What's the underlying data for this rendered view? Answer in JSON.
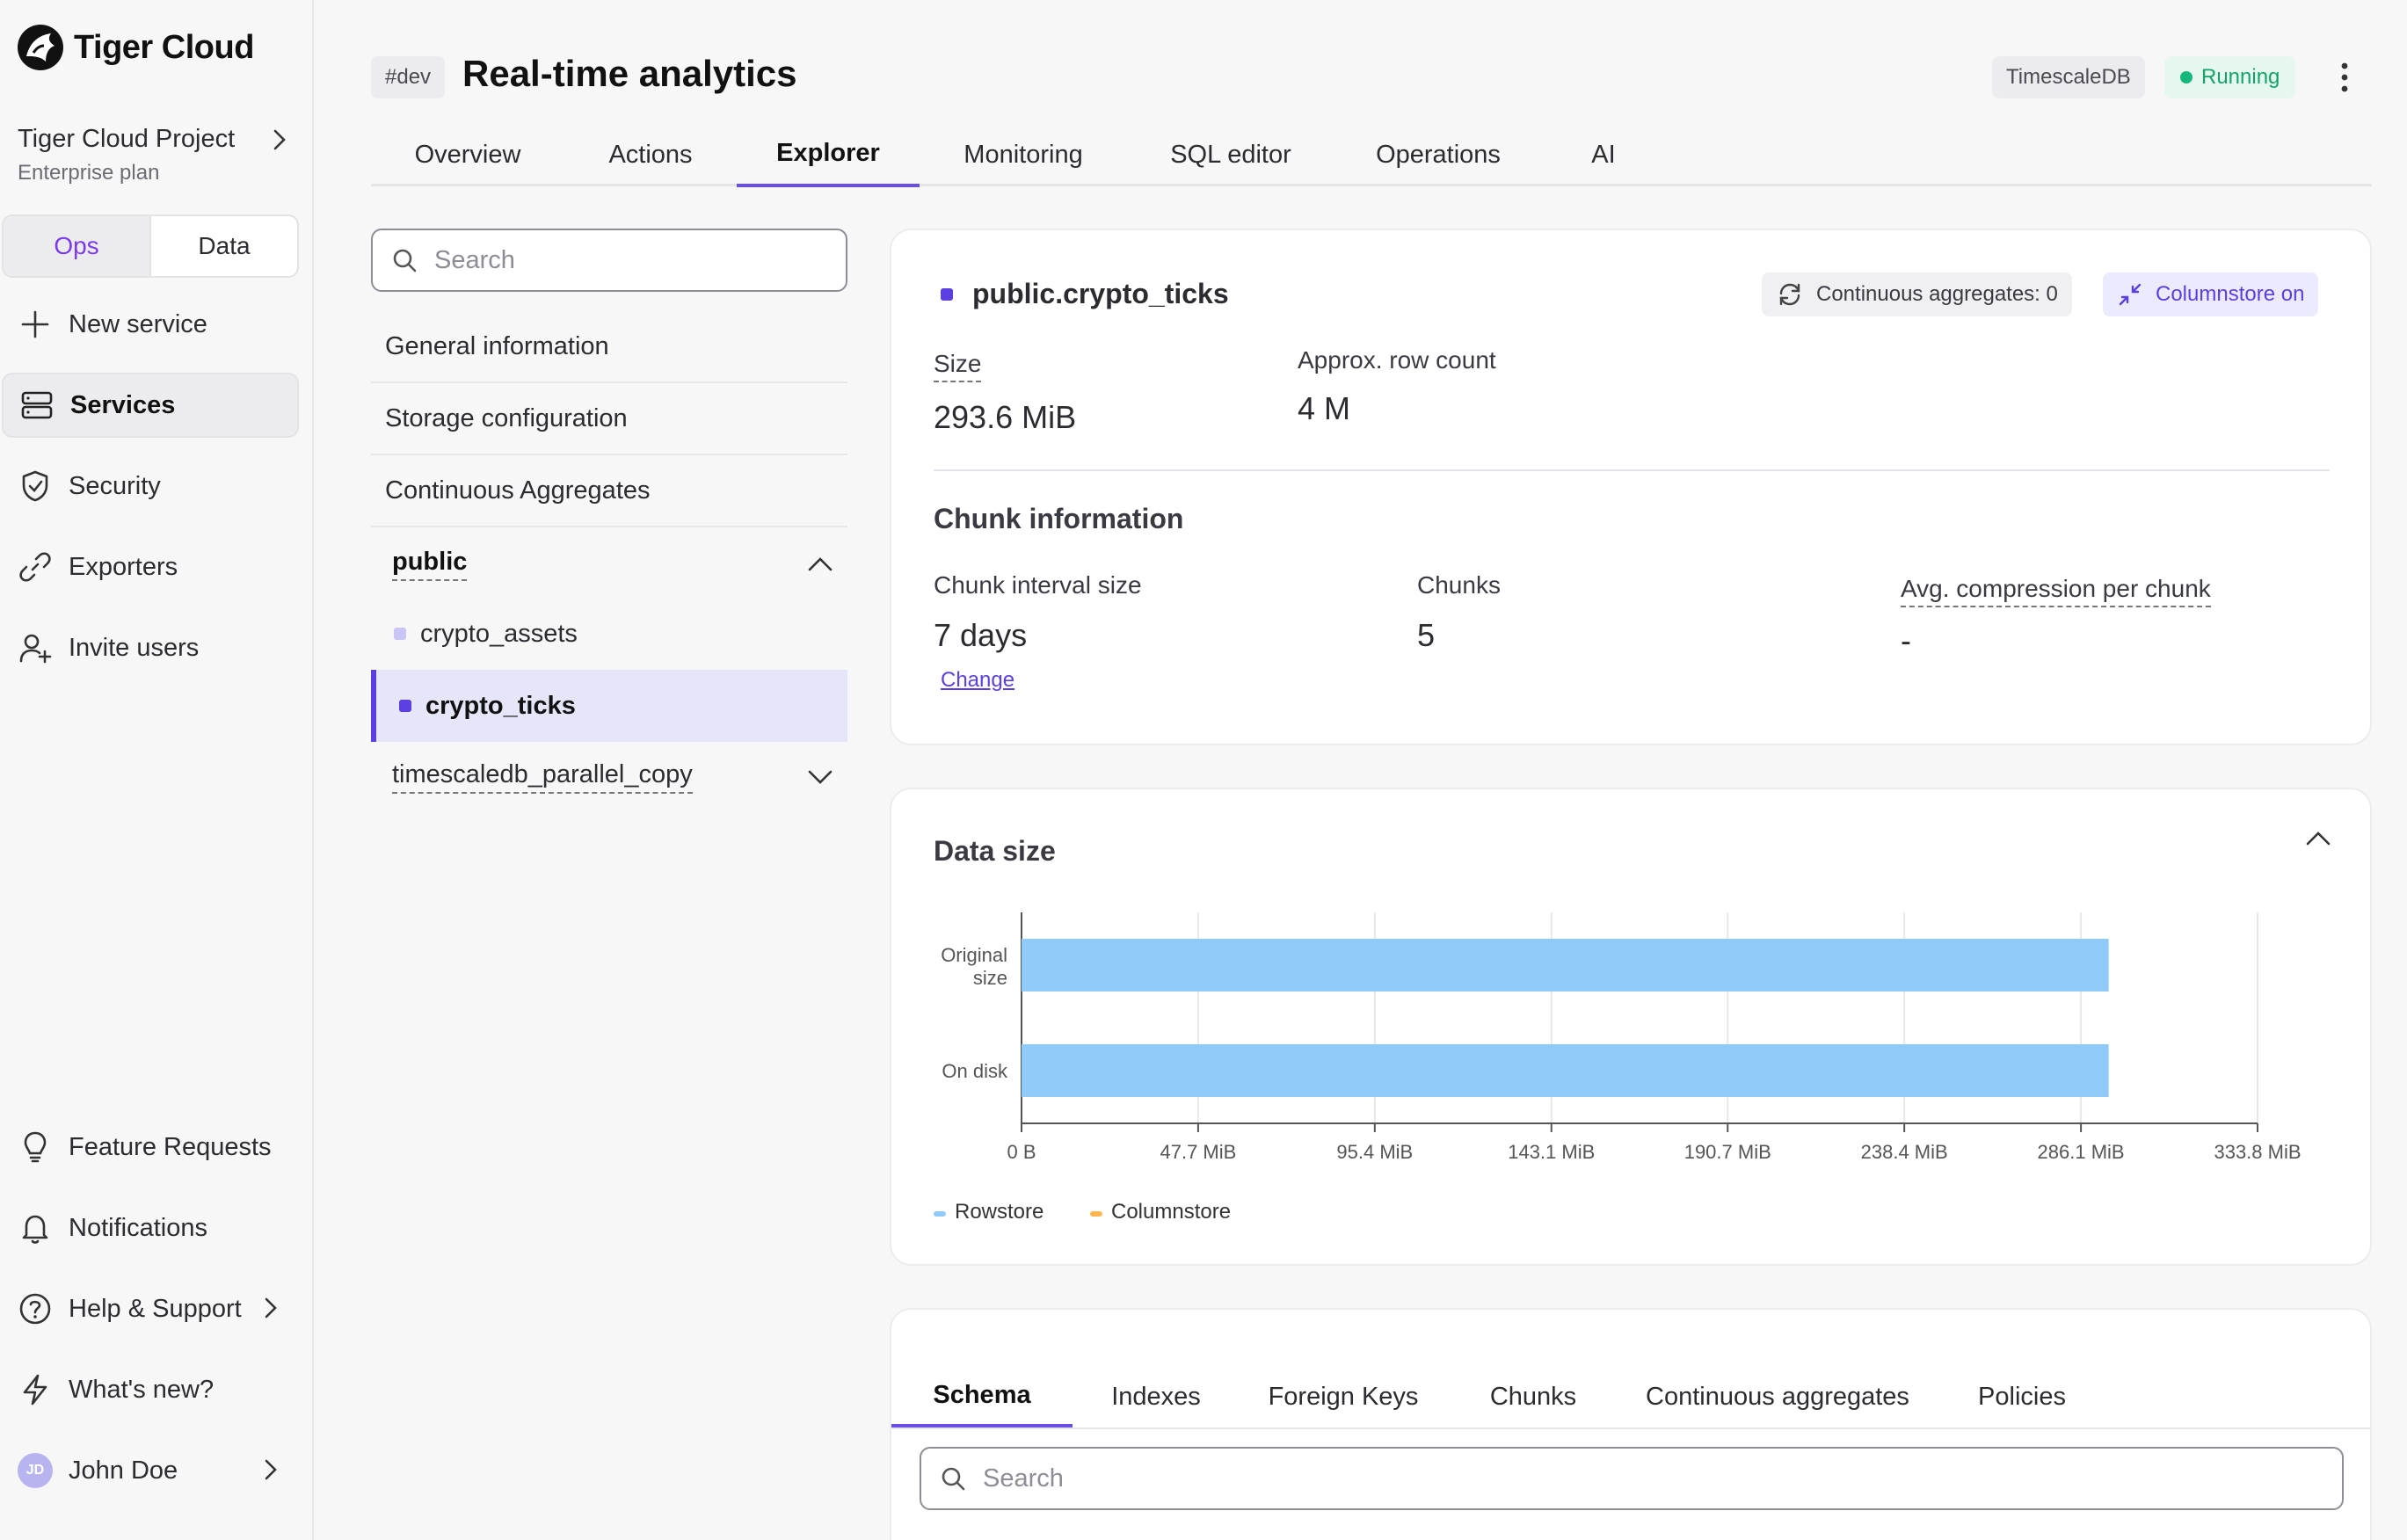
{
  "sidebar": {
    "brand": "Tiger Cloud",
    "project_name": "Tiger Cloud Project",
    "project_plan": "Enterprise plan",
    "mode_tabs": [
      "Ops",
      "Data"
    ],
    "nav": [
      {
        "label": "New service",
        "icon": "plus-icon"
      },
      {
        "label": "Services",
        "icon": "server-icon",
        "active": true
      },
      {
        "label": "Security",
        "icon": "shield-check-icon"
      },
      {
        "label": "Exporters",
        "icon": "link-icon"
      },
      {
        "label": "Invite users",
        "icon": "user-plus-icon"
      }
    ],
    "bottom_nav": [
      {
        "label": "Feature Requests",
        "icon": "lightbulb-icon"
      },
      {
        "label": "Notifications",
        "icon": "bell-icon"
      },
      {
        "label": "Help & Support",
        "icon": "help-circle-icon"
      },
      {
        "label": "What's new?",
        "icon": "zap-icon"
      }
    ],
    "user": {
      "initials": "JD",
      "name": "John Doe"
    }
  },
  "header": {
    "env_tag": "#dev",
    "title": "Real-time analytics",
    "db_badge": "TimescaleDB",
    "status": "Running",
    "status_color": "#14b87a"
  },
  "tabs": [
    "Overview",
    "Actions",
    "Explorer",
    "Monitoring",
    "SQL editor",
    "Operations",
    "AI"
  ],
  "active_tab": "Explorer",
  "explorer": {
    "search_placeholder": "Search",
    "sections": [
      "General information",
      "Storage configuration",
      "Continuous Aggregates"
    ],
    "schemas": [
      {
        "name": "public",
        "expanded": true,
        "tables": [
          "crypto_assets",
          "crypto_ticks"
        ]
      },
      {
        "name": "timescaledb_parallel_copy",
        "expanded": false
      }
    ],
    "selected_table": "crypto_ticks"
  },
  "table_card": {
    "name": "public.crypto_ticks",
    "cagg_pill": "Continuous aggregates: 0",
    "columnstore_pill": "Columnstore on",
    "size_label": "Size",
    "size_value": "293.6 MiB",
    "rows_label": "Approx. row count",
    "rows_value": "4 M",
    "chunk_heading": "Chunk information",
    "interval_label": "Chunk interval size",
    "interval_value": "7 days",
    "change_link": "Change",
    "chunks_label": "Chunks",
    "chunks_value": "5",
    "compression_label": "Avg. compression per chunk",
    "compression_value": "-"
  },
  "data_size": {
    "heading": "Data size",
    "legend": [
      {
        "label": "Rowstore",
        "color": "#90caf9"
      },
      {
        "label": "Columnstore",
        "color": "#ffb74d"
      }
    ]
  },
  "chart_data": {
    "type": "bar",
    "orientation": "horizontal",
    "categories": [
      "Original size",
      "On disk"
    ],
    "series": [
      {
        "name": "Rowstore",
        "values": [
          293.6,
          293.6
        ]
      },
      {
        "name": "Columnstore",
        "values": [
          0,
          0
        ]
      }
    ],
    "xlim": [
      0,
      333.8
    ],
    "x_ticks": [
      "0 B",
      "47.7 MiB",
      "95.4 MiB",
      "143.1 MiB",
      "190.7 MiB",
      "238.4 MiB",
      "286.1 MiB",
      "333.8 MiB"
    ],
    "x_tick_values": [
      0,
      47.7,
      95.4,
      143.1,
      190.7,
      238.4,
      286.1,
      333.8
    ],
    "grid": true,
    "legend_position": "bottom-left",
    "colors": {
      "rowstore": "#90caf9",
      "columnstore": "#ffb74d"
    }
  },
  "detail_tabs": [
    "Schema",
    "Indexes",
    "Foreign Keys",
    "Chunks",
    "Continuous aggregates",
    "Policies"
  ],
  "active_detail_tab": "Schema",
  "detail_search_placeholder": "Search"
}
